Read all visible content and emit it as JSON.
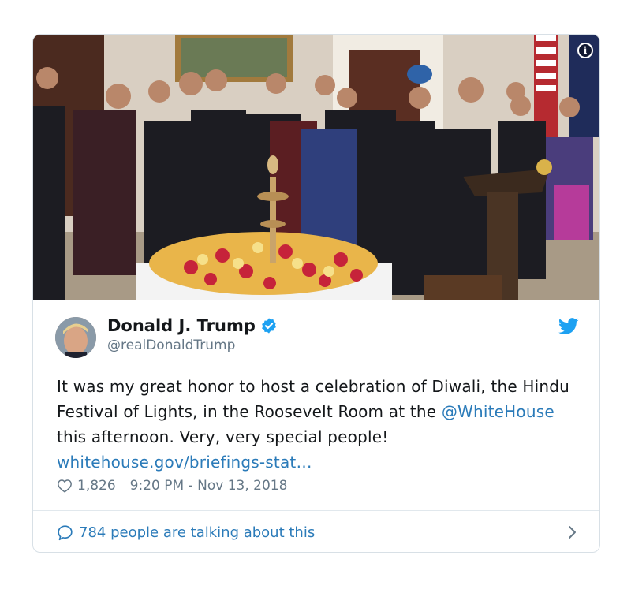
{
  "tweet": {
    "display_name": "Donald J. Trump",
    "handle": "@realDonaldTrump",
    "text_part1": "It was my great honor to host a celebration of Diwali, the Hindu Festival of Lights, in the Roosevelt Room at the ",
    "mention": "@WhiteHouse",
    "text_part2": " this afternoon. Very, very special people! ",
    "link": "whitehouse.gov/briefings-stat…",
    "likes": "1,826",
    "timestamp": "9:20 PM - Nov 13, 2018",
    "conversation": "784 people are talking about this"
  },
  "icons": {
    "info": "info-icon",
    "verified": "verified-badge-icon",
    "platform": "twitter-bird-icon",
    "like": "heart-icon",
    "reply": "speech-bubble-icon",
    "more": "chevron-right-icon"
  },
  "colors": {
    "text": "#14171a",
    "secondary": "#657786",
    "link": "#2b7bb9",
    "verified": "#1da1f2",
    "border": "#d8e0e6"
  }
}
